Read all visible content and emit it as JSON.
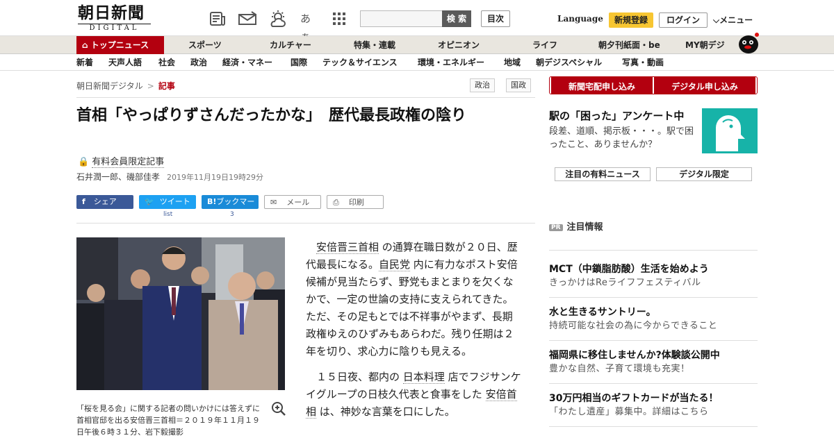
{
  "header": {
    "logo_main": "朝日新聞",
    "logo_sub": "DIGITAL",
    "icon_font_label": "あぁ",
    "search_button": "検 索",
    "index_button": "目次",
    "language": "Language",
    "register": "新規登録",
    "login": "ログイン",
    "menu": "メニュー"
  },
  "nav_main": [
    "トップニュース",
    "スポーツ",
    "カルチャー",
    "特集・連載",
    "オピニオン",
    "ライフ",
    "朝夕刊紙面・be",
    "MY朝デジ"
  ],
  "nav_sub": [
    "新着",
    "天声人語",
    "社会",
    "政治",
    "経済・マネー",
    "国際",
    "テック＆サイエンス",
    "環境・エネルギー",
    "地域",
    "朝デジスペシャル",
    "写真・動画"
  ],
  "breadcrumb": {
    "home": "朝日新聞デジタル",
    "sep": ">",
    "current": "記事"
  },
  "tags": [
    "政治",
    "国政"
  ],
  "article": {
    "title": "首相「やっぱりずさんだったかな」　歴代最長政権の陰り",
    "paid_label": "有料会員限定記事",
    "authors": "石井潤一郎、磯部佳孝",
    "date": "2019年11月19日19時29分",
    "share": {
      "facebook": "シェア",
      "twitter": "ツイート",
      "hatena": "ブックマーク",
      "hatena_logo": "B!",
      "mail": "メール",
      "print": "印刷"
    },
    "share_counts": {
      "twitter": "list",
      "hatena": "3"
    },
    "caption": "「桜を見る会」に関する記者の問いかけには答えずに首相官邸を出る安倍晋三首相＝２０１９年１１月１９日午後６時３１分、岩下毅撮影",
    "p1": {
      "a": "安倍晋三首相",
      "b": " の通算在職日数が２０日、歴代最長になる。",
      "c": "自民党",
      "d": " 内に有力なポスト安倍候補が見当たらず、野党もまとまりを欠くなかで、一定の世論の支持に支えられてきた。ただ、その足もとでは不祥事がやまず、長期政権ゆえのひずみもあらわだ。残り任期は２年を切り、求心力に陰りも見える。"
    },
    "p2": {
      "a": "１５日夜、都内の ",
      "b": "日本料理",
      "c": " 店でフジサンケイグループの日枝久代表と食事をした ",
      "d": "安倍首相",
      "e": " は、神妙な言葉を口にした。"
    }
  },
  "sidebar": {
    "delivery_button": "新聞宅配申し込み",
    "digital_button": "デジタル申し込み",
    "ad_title": "駅の「困った」アンケート中",
    "ad_text": "段差、道順、掲示板・・・。駅で困ったこと、ありませんか？",
    "tab1": "注目の有料ニュース",
    "tab2": "デジタル限定",
    "pr_badge": "PR",
    "pr_heading": "注目情報",
    "pr_items": [
      {
        "title": "MCT（中鎖脂肪酸）生活を始めよう",
        "sub": "きっかけはReライフフェスティバル"
      },
      {
        "title": "水と生きるサントリー。",
        "sub": "持続可能な社会の為に今からできること"
      },
      {
        "title": "福岡県に移住しませんか?体験談公開中",
        "sub": "豊かな自然、子育て環境も充実！"
      },
      {
        "title": "30万円相当のギフトカードが当たる！",
        "sub": "「わたし遺産」募集中。詳細はこちら"
      }
    ]
  },
  "colors": {
    "brand_red": "#b3000f",
    "accent_yellow": "#f7c632",
    "ad_teal": "#17b3a8"
  }
}
